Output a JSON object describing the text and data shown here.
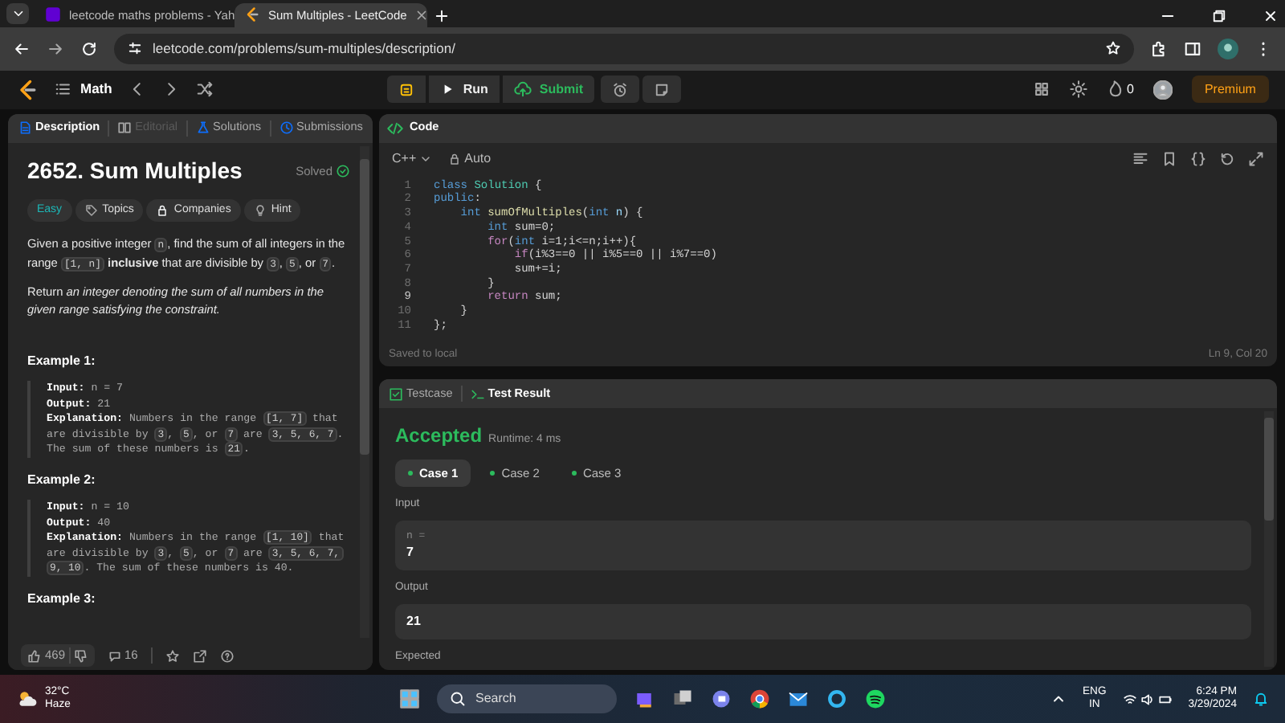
{
  "browser": {
    "tabs": [
      {
        "title": "leetcode maths problems - Yah",
        "selected": false
      },
      {
        "title": "Sum Multiples - LeetCode",
        "selected": true
      }
    ],
    "url": "leetcode.com/problems/sum-multiples/description/"
  },
  "header": {
    "section": "Math",
    "run": "Run",
    "submit": "Submit",
    "streak": "0",
    "premium": "Premium"
  },
  "problem": {
    "tabs": [
      {
        "label": "Description",
        "selected": true,
        "disabled": false
      },
      {
        "label": "Editorial",
        "selected": false,
        "disabled": true
      },
      {
        "label": "Solutions",
        "selected": false,
        "disabled": false
      },
      {
        "label": "Submissions",
        "selected": false,
        "disabled": false
      }
    ],
    "title": "2652. Sum Multiples",
    "status": "Solved",
    "tags": [
      {
        "label": "Easy",
        "kind": "difficulty"
      },
      {
        "label": "Topics",
        "kind": "topics"
      },
      {
        "label": "Companies",
        "kind": "companies"
      },
      {
        "label": "Hint",
        "kind": "hint"
      }
    ],
    "paragraphs": [
      [
        {
          "kind": "text",
          "text": "Given a positive integer "
        },
        {
          "kind": "code",
          "text": "n"
        },
        {
          "kind": "text",
          "text": ", find the sum of all integers in the range "
        },
        {
          "kind": "code",
          "text": "[1, n]"
        },
        {
          "kind": "text",
          "text": " **inclusive** that are divisible by "
        },
        {
          "kind": "code",
          "text": "3"
        },
        {
          "kind": "text",
          "text": ", "
        },
        {
          "kind": "code",
          "text": "5"
        },
        {
          "kind": "text",
          "text": ", or "
        },
        {
          "kind": "code",
          "text": "7"
        },
        {
          "kind": "text",
          "text": "."
        }
      ],
      [
        {
          "kind": "text",
          "text": "Return *an integer denoting the sum of all numbers in the given range satisfying the constraint.*"
        }
      ]
    ],
    "examples": [
      {
        "title": "Example 1:",
        "lines": [
          {
            "label": "Input:",
            "parts": [
              {
                "kind": "text",
                "text": "n = 7"
              }
            ]
          },
          {
            "label": "Output:",
            "parts": [
              {
                "kind": "text",
                "text": "21"
              }
            ]
          },
          {
            "label": "Explanation:",
            "parts": [
              {
                "kind": "text",
                "text": "Numbers in the range "
              },
              {
                "kind": "code",
                "text": "[1, 7]"
              },
              {
                "kind": "text",
                "text": " that are divisible by "
              },
              {
                "kind": "code",
                "text": "3"
              },
              {
                "kind": "text",
                "text": ", "
              },
              {
                "kind": "code",
                "text": "5"
              },
              {
                "kind": "text",
                "text": ", or "
              },
              {
                "kind": "code",
                "text": "7"
              },
              {
                "kind": "text",
                "text": " are "
              },
              {
                "kind": "code",
                "text": "3, 5, 6, 7"
              },
              {
                "kind": "text",
                "text": ". The sum of these numbers is "
              },
              {
                "kind": "code",
                "text": "21"
              },
              {
                "kind": "text",
                "text": "."
              }
            ]
          }
        ]
      },
      {
        "title": "Example 2:",
        "lines": [
          {
            "label": "Input:",
            "parts": [
              {
                "kind": "text",
                "text": "n = 10"
              }
            ]
          },
          {
            "label": "Output:",
            "parts": [
              {
                "kind": "text",
                "text": "40"
              }
            ]
          },
          {
            "label": "Explanation:",
            "parts": [
              {
                "kind": "text",
                "text": "Numbers in the range "
              },
              {
                "kind": "code",
                "text": "[1, 10]"
              },
              {
                "kind": "text",
                "text": " that are divisible by "
              },
              {
                "kind": "code",
                "text": "3"
              },
              {
                "kind": "text",
                "text": ", "
              },
              {
                "kind": "code",
                "text": "5"
              },
              {
                "kind": "text",
                "text": ", or "
              },
              {
                "kind": "code",
                "text": "7"
              },
              {
                "kind": "text",
                "text": " are "
              },
              {
                "kind": "code",
                "text": "3, 5, 6, 7, 9, 10"
              },
              {
                "kind": "text",
                "text": ". The sum of these numbers is 40."
              }
            ]
          }
        ]
      },
      {
        "title": "Example 3:"
      }
    ],
    "likes": "469",
    "comments": "16"
  },
  "editor": {
    "title": "Code",
    "language": "C++",
    "mode": "Auto",
    "lines": [
      {
        "number": "1",
        "current": false,
        "tokens": [
          {
            "kind": "kw",
            "text": "class"
          },
          {
            "kind": "type",
            "text": " Solution"
          },
          {
            "kind": "plain",
            "text": " {"
          }
        ]
      },
      {
        "number": "2",
        "current": false,
        "tokens": [
          {
            "kind": "kw",
            "text": "public"
          },
          {
            "kind": "plain",
            "text": ":"
          }
        ]
      },
      {
        "number": "3",
        "current": false,
        "tokens": [
          {
            "kind": "kw",
            "text": "    int"
          },
          {
            "kind": "fn",
            "text": " sumOfMultiples"
          },
          {
            "kind": "plain",
            "text": "("
          },
          {
            "kind": "kw",
            "text": "int"
          },
          {
            "kind": "var",
            "text": " n"
          },
          {
            "kind": "plain",
            "text": ") {"
          }
        ]
      },
      {
        "number": "4",
        "current": false,
        "tokens": [
          {
            "kind": "kw",
            "text": "        int"
          },
          {
            "kind": "plain",
            "text": " sum=0;"
          }
        ]
      },
      {
        "number": "5",
        "current": false,
        "tokens": [
          {
            "kind": "ctl",
            "text": "        for"
          },
          {
            "kind": "plain",
            "text": "("
          },
          {
            "kind": "kw",
            "text": "int"
          },
          {
            "kind": "plain",
            "text": " i=1;i<=n;i++){"
          }
        ]
      },
      {
        "number": "6",
        "current": false,
        "tokens": [
          {
            "kind": "ctl",
            "text": "            if"
          },
          {
            "kind": "plain",
            "text": "(i%3==0 || i%5==0 || i%7==0)"
          }
        ]
      },
      {
        "number": "7",
        "current": false,
        "tokens": [
          {
            "kind": "plain",
            "text": "            sum+=i;"
          }
        ]
      },
      {
        "number": "8",
        "current": false,
        "tokens": [
          {
            "kind": "plain",
            "text": "        }"
          }
        ]
      },
      {
        "number": "9",
        "current": true,
        "tokens": [
          {
            "kind": "ctl",
            "text": "        return"
          },
          {
            "kind": "plain",
            "text": " sum;"
          }
        ]
      },
      {
        "number": "10",
        "current": false,
        "tokens": [
          {
            "kind": "plain",
            "text": "    }"
          }
        ]
      },
      {
        "number": "11",
        "current": false,
        "tokens": [
          {
            "kind": "plain",
            "text": "};"
          }
        ]
      }
    ],
    "saved": "Saved to local",
    "cursor": "Ln 9, Col 20"
  },
  "result": {
    "tabs": [
      {
        "label": "Testcase",
        "selected": false
      },
      {
        "label": "Test Result",
        "selected": true
      }
    ],
    "verdict": "Accepted",
    "runtime": "Runtime: 4 ms",
    "cases": [
      {
        "label": "Case 1",
        "selected": true,
        "passed": true
      },
      {
        "label": "Case 2",
        "selected": false,
        "passed": true
      },
      {
        "label": "Case 3",
        "selected": false,
        "passed": true
      }
    ],
    "sections": [
      {
        "label": "Input",
        "fields": [
          {
            "name": "n =",
            "value": "7"
          }
        ]
      },
      {
        "label": "Output",
        "fields": [
          {
            "value": "21"
          }
        ]
      },
      {
        "label": "Expected"
      }
    ]
  },
  "taskbar": {
    "temperature": "32°C",
    "condition": "Haze",
    "search": "Search",
    "language": "ENG",
    "region": "IN",
    "time": "6:24 PM",
    "date": "3/29/2024"
  }
}
